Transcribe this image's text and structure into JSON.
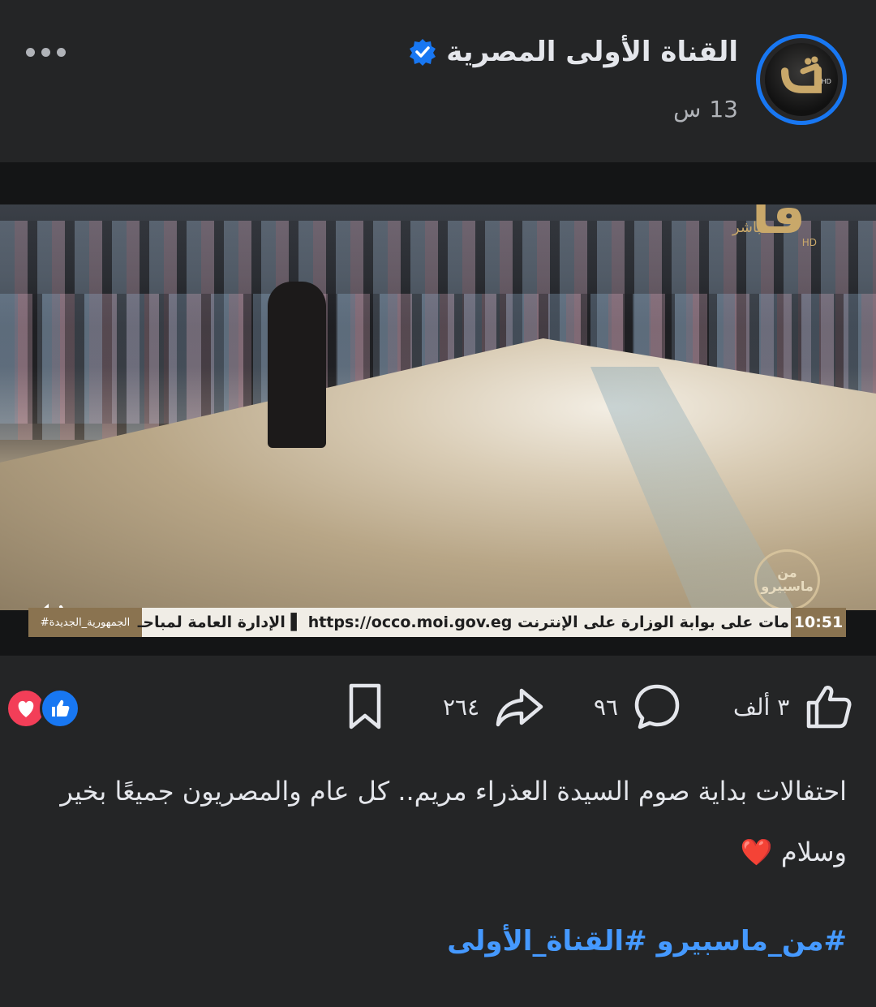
{
  "header": {
    "page_name": "القناة الأولى المصرية",
    "time_value": "13",
    "time_unit": "س"
  },
  "video": {
    "channel_logo_live": "مباشر",
    "channel_logo_hd": "HD",
    "program_logo_text": "من ماسبيرو",
    "ticker": {
      "time": "10:51",
      "text": "مات على بوابة الوزارة على الإنترنت https://occo.moi.gov.eg ▌ الإدارة العامة لمباحـ",
      "tag": "#الجمهورية_الجديدة"
    }
  },
  "actions": {
    "likes": "٣ ألف",
    "comments": "٩٦",
    "shares": "٢٦٤"
  },
  "post": {
    "text": "احتفالات بداية صوم السيدة العذراء مريم.. كل عام والمصريون جميعًا بخير وسلام ❤️",
    "hashtags": [
      "#من_ماسبيرو",
      "#القناة_الأولى"
    ]
  },
  "colors": {
    "background": "#242526",
    "accent": "#1877f2",
    "hashtag": "#4599ff",
    "love_reaction": "#f33e58"
  }
}
